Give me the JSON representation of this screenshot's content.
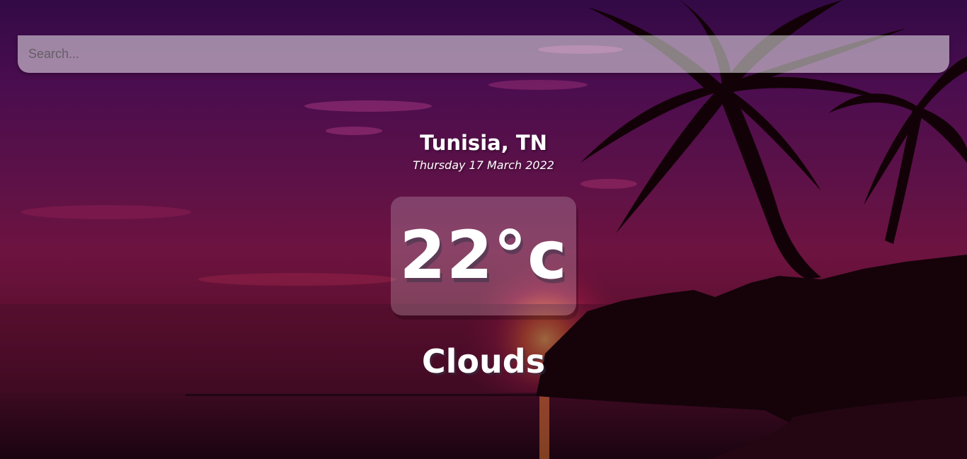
{
  "search": {
    "placeholder": "Search..."
  },
  "location": {
    "city_country": "Tunisia, TN",
    "date": "Thursday 17 March 2022"
  },
  "weather": {
    "temperature": "22°c",
    "condition": "Clouds"
  },
  "background": {
    "icons": [
      "palm-tree",
      "sunset",
      "sea"
    ],
    "colors": {
      "sky_top": "#320a45",
      "sky_mid": "#6d1340",
      "sea": "#1e0510"
    }
  }
}
